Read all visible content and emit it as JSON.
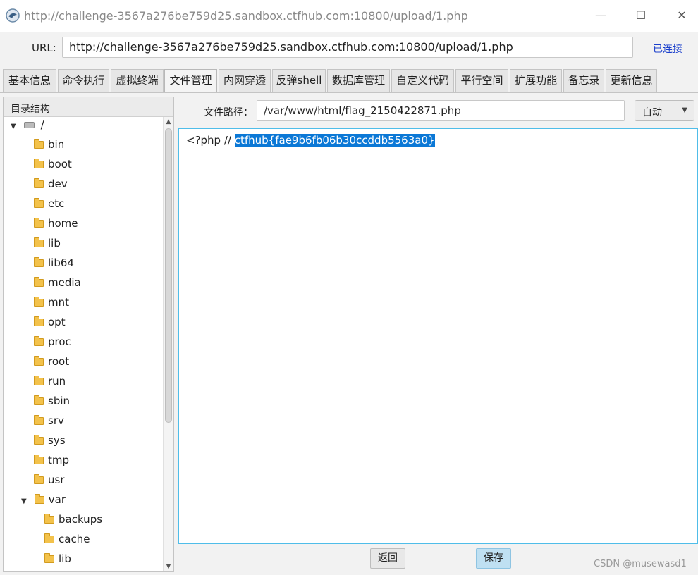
{
  "window": {
    "title": "http://challenge-3567a276be759d25.sandbox.ctfhub.com:10800/upload/1.php",
    "minimize_glyph": "—",
    "maximize_glyph": "☐",
    "close_glyph": "✕"
  },
  "urlbar": {
    "label": "URL:",
    "value": "http://challenge-3567a276be759d25.sandbox.ctfhub.com:10800/upload/1.php",
    "status": "已连接",
    "status_color": "#1a3fcc"
  },
  "tabs": [
    {
      "label": "基本信息"
    },
    {
      "label": "命令执行"
    },
    {
      "label": "虚拟终端"
    },
    {
      "label": "文件管理",
      "active": true
    },
    {
      "label": "内网穿透"
    },
    {
      "label": "反弹shell"
    },
    {
      "label": "数据库管理"
    },
    {
      "label": "自定义代码"
    },
    {
      "label": "平行空间"
    },
    {
      "label": "扩展功能"
    },
    {
      "label": "备忘录"
    },
    {
      "label": "更新信息"
    }
  ],
  "sidebar": {
    "header": "目录结构",
    "root": {
      "label": "/",
      "icon": "drive-icon",
      "expanded": true
    },
    "items": [
      {
        "label": "bin"
      },
      {
        "label": "boot"
      },
      {
        "label": "dev"
      },
      {
        "label": "etc"
      },
      {
        "label": "home"
      },
      {
        "label": "lib"
      },
      {
        "label": "lib64"
      },
      {
        "label": "media"
      },
      {
        "label": "mnt"
      },
      {
        "label": "opt"
      },
      {
        "label": "proc"
      },
      {
        "label": "root"
      },
      {
        "label": "run"
      },
      {
        "label": "sbin"
      },
      {
        "label": "srv"
      },
      {
        "label": "sys"
      },
      {
        "label": "tmp"
      },
      {
        "label": "usr"
      }
    ],
    "var": {
      "label": "var",
      "expanded": true,
      "children": [
        {
          "label": "backups"
        },
        {
          "label": "cache"
        },
        {
          "label": "lib"
        }
      ]
    }
  },
  "filepath": {
    "label": "文件路径：",
    "value": "/var/www/html/flag_2150422871.php",
    "encoding": "自动"
  },
  "editor": {
    "code_prefix": "<?php // ",
    "code_selected": "ctfhub{fae9b6fb06b30ccddb5563a0}",
    "selection_color": "#0b78d6"
  },
  "buttons": {
    "back": "返回",
    "save": "保存"
  },
  "watermark": "CSDN @musewasd1"
}
